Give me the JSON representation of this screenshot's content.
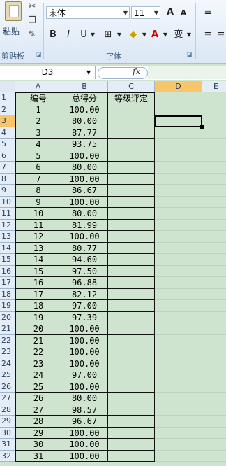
{
  "ribbon": {
    "clipboard": {
      "paste_label": "粘贴",
      "group_label": "剪贴板"
    },
    "font": {
      "font_name": "宋体",
      "font_size": "11",
      "group_label": "字体",
      "bold": "B",
      "italic": "I",
      "underline": "U",
      "grow": "A",
      "shrink": "A",
      "font_color": "A",
      "phonetic": "变"
    }
  },
  "formula_bar": {
    "name_box": "D3",
    "fx": "fx",
    "value": ""
  },
  "grid": {
    "columns": [
      "A",
      "B",
      "C",
      "D",
      "E"
    ],
    "row_numbers": [
      "1",
      "2",
      "3",
      "4",
      "5",
      "6",
      "7",
      "8",
      "9",
      "10",
      "11",
      "12",
      "13",
      "14",
      "15",
      "16",
      "17",
      "18",
      "19",
      "20",
      "21",
      "22",
      "23",
      "24",
      "25",
      "26",
      "27",
      "28",
      "29",
      "30",
      "31",
      "32"
    ],
    "headers": [
      "编号",
      "总得分",
      "等级评定"
    ],
    "rows": [
      [
        "1",
        "100.00"
      ],
      [
        "2",
        "80.00"
      ],
      [
        "3",
        "87.77"
      ],
      [
        "4",
        "93.75"
      ],
      [
        "5",
        "100.00"
      ],
      [
        "6",
        "80.00"
      ],
      [
        "7",
        "100.00"
      ],
      [
        "8",
        "86.67"
      ],
      [
        "9",
        "100.00"
      ],
      [
        "10",
        "80.00"
      ],
      [
        "11",
        "81.99"
      ],
      [
        "12",
        "100.00"
      ],
      [
        "13",
        "80.77"
      ],
      [
        "14",
        "94.60"
      ],
      [
        "15",
        "97.50"
      ],
      [
        "16",
        "96.88"
      ],
      [
        "17",
        "82.12"
      ],
      [
        "18",
        "97.00"
      ],
      [
        "19",
        "97.39"
      ],
      [
        "20",
        "100.00"
      ],
      [
        "21",
        "100.00"
      ],
      [
        "22",
        "100.00"
      ],
      [
        "23",
        "100.00"
      ],
      [
        "24",
        "97.00"
      ],
      [
        "25",
        "100.00"
      ],
      [
        "26",
        "80.00"
      ],
      [
        "27",
        "98.57"
      ],
      [
        "28",
        "96.67"
      ],
      [
        "29",
        "100.00"
      ],
      [
        "30",
        "100.00"
      ],
      [
        "31",
        "100.00"
      ]
    ],
    "active_cell": "D3"
  }
}
